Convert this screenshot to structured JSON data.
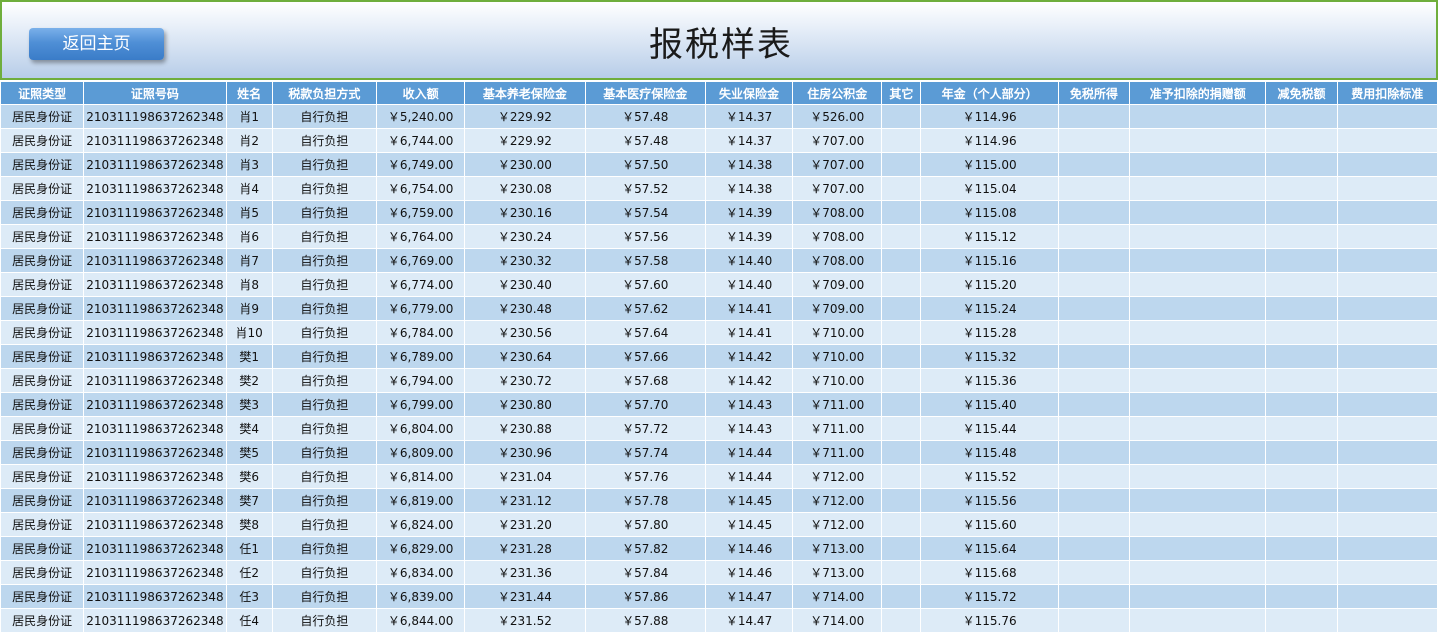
{
  "header": {
    "home_button": "返回主页",
    "title": "报税样表"
  },
  "table": {
    "columns": [
      "证照类型",
      "证照号码",
      "姓名",
      "税款负担方式",
      "收入额",
      "基本养老保险金",
      "基本医疗保险金",
      "失业保险金",
      "住房公积金",
      "其它",
      "年金（个人部分）",
      "免税所得",
      "准予扣除的捐赠额",
      "减免税额",
      "费用扣除标准"
    ],
    "rows": [
      [
        "居民身份证",
        "210311198637262348",
        "肖1",
        "自行负担",
        "￥5,240.00",
        "￥229.92",
        "￥57.48",
        "￥14.37",
        "￥526.00",
        "",
        "￥114.96",
        "",
        "",
        "",
        ""
      ],
      [
        "居民身份证",
        "210311198637262348",
        "肖2",
        "自行负担",
        "￥6,744.00",
        "￥229.92",
        "￥57.48",
        "￥14.37",
        "￥707.00",
        "",
        "￥114.96",
        "",
        "",
        "",
        ""
      ],
      [
        "居民身份证",
        "210311198637262348",
        "肖3",
        "自行负担",
        "￥6,749.00",
        "￥230.00",
        "￥57.50",
        "￥14.38",
        "￥707.00",
        "",
        "￥115.00",
        "",
        "",
        "",
        ""
      ],
      [
        "居民身份证",
        "210311198637262348",
        "肖4",
        "自行负担",
        "￥6,754.00",
        "￥230.08",
        "￥57.52",
        "￥14.38",
        "￥707.00",
        "",
        "￥115.04",
        "",
        "",
        "",
        ""
      ],
      [
        "居民身份证",
        "210311198637262348",
        "肖5",
        "自行负担",
        "￥6,759.00",
        "￥230.16",
        "￥57.54",
        "￥14.39",
        "￥708.00",
        "",
        "￥115.08",
        "",
        "",
        "",
        ""
      ],
      [
        "居民身份证",
        "210311198637262348",
        "肖6",
        "自行负担",
        "￥6,764.00",
        "￥230.24",
        "￥57.56",
        "￥14.39",
        "￥708.00",
        "",
        "￥115.12",
        "",
        "",
        "",
        ""
      ],
      [
        "居民身份证",
        "210311198637262348",
        "肖7",
        "自行负担",
        "￥6,769.00",
        "￥230.32",
        "￥57.58",
        "￥14.40",
        "￥708.00",
        "",
        "￥115.16",
        "",
        "",
        "",
        ""
      ],
      [
        "居民身份证",
        "210311198637262348",
        "肖8",
        "自行负担",
        "￥6,774.00",
        "￥230.40",
        "￥57.60",
        "￥14.40",
        "￥709.00",
        "",
        "￥115.20",
        "",
        "",
        "",
        ""
      ],
      [
        "居民身份证",
        "210311198637262348",
        "肖9",
        "自行负担",
        "￥6,779.00",
        "￥230.48",
        "￥57.62",
        "￥14.41",
        "￥709.00",
        "",
        "￥115.24",
        "",
        "",
        "",
        ""
      ],
      [
        "居民身份证",
        "210311198637262348",
        "肖10",
        "自行负担",
        "￥6,784.00",
        "￥230.56",
        "￥57.64",
        "￥14.41",
        "￥710.00",
        "",
        "￥115.28",
        "",
        "",
        "",
        ""
      ],
      [
        "居民身份证",
        "210311198637262348",
        "樊1",
        "自行负担",
        "￥6,789.00",
        "￥230.64",
        "￥57.66",
        "￥14.42",
        "￥710.00",
        "",
        "￥115.32",
        "",
        "",
        "",
        ""
      ],
      [
        "居民身份证",
        "210311198637262348",
        "樊2",
        "自行负担",
        "￥6,794.00",
        "￥230.72",
        "￥57.68",
        "￥14.42",
        "￥710.00",
        "",
        "￥115.36",
        "",
        "",
        "",
        ""
      ],
      [
        "居民身份证",
        "210311198637262348",
        "樊3",
        "自行负担",
        "￥6,799.00",
        "￥230.80",
        "￥57.70",
        "￥14.43",
        "￥711.00",
        "",
        "￥115.40",
        "",
        "",
        "",
        ""
      ],
      [
        "居民身份证",
        "210311198637262348",
        "樊4",
        "自行负担",
        "￥6,804.00",
        "￥230.88",
        "￥57.72",
        "￥14.43",
        "￥711.00",
        "",
        "￥115.44",
        "",
        "",
        "",
        ""
      ],
      [
        "居民身份证",
        "210311198637262348",
        "樊5",
        "自行负担",
        "￥6,809.00",
        "￥230.96",
        "￥57.74",
        "￥14.44",
        "￥711.00",
        "",
        "￥115.48",
        "",
        "",
        "",
        ""
      ],
      [
        "居民身份证",
        "210311198637262348",
        "樊6",
        "自行负担",
        "￥6,814.00",
        "￥231.04",
        "￥57.76",
        "￥14.44",
        "￥712.00",
        "",
        "￥115.52",
        "",
        "",
        "",
        ""
      ],
      [
        "居民身份证",
        "210311198637262348",
        "樊7",
        "自行负担",
        "￥6,819.00",
        "￥231.12",
        "￥57.78",
        "￥14.45",
        "￥712.00",
        "",
        "￥115.56",
        "",
        "",
        "",
        ""
      ],
      [
        "居民身份证",
        "210311198637262348",
        "樊8",
        "自行负担",
        "￥6,824.00",
        "￥231.20",
        "￥57.80",
        "￥14.45",
        "￥712.00",
        "",
        "￥115.60",
        "",
        "",
        "",
        ""
      ],
      [
        "居民身份证",
        "210311198637262348",
        "任1",
        "自行负担",
        "￥6,829.00",
        "￥231.28",
        "￥57.82",
        "￥14.46",
        "￥713.00",
        "",
        "￥115.64",
        "",
        "",
        "",
        ""
      ],
      [
        "居民身份证",
        "210311198637262348",
        "任2",
        "自行负担",
        "￥6,834.00",
        "￥231.36",
        "￥57.84",
        "￥14.46",
        "￥713.00",
        "",
        "￥115.68",
        "",
        "",
        "",
        ""
      ],
      [
        "居民身份证",
        "210311198637262348",
        "任3",
        "自行负担",
        "￥6,839.00",
        "￥231.44",
        "￥57.86",
        "￥14.47",
        "￥714.00",
        "",
        "￥115.72",
        "",
        "",
        "",
        ""
      ],
      [
        "居民身份证",
        "210311198637262348",
        "任4",
        "自行负担",
        "￥6,844.00",
        "￥231.52",
        "￥57.88",
        "￥14.47",
        "￥714.00",
        "",
        "￥115.76",
        "",
        "",
        "",
        ""
      ]
    ]
  }
}
